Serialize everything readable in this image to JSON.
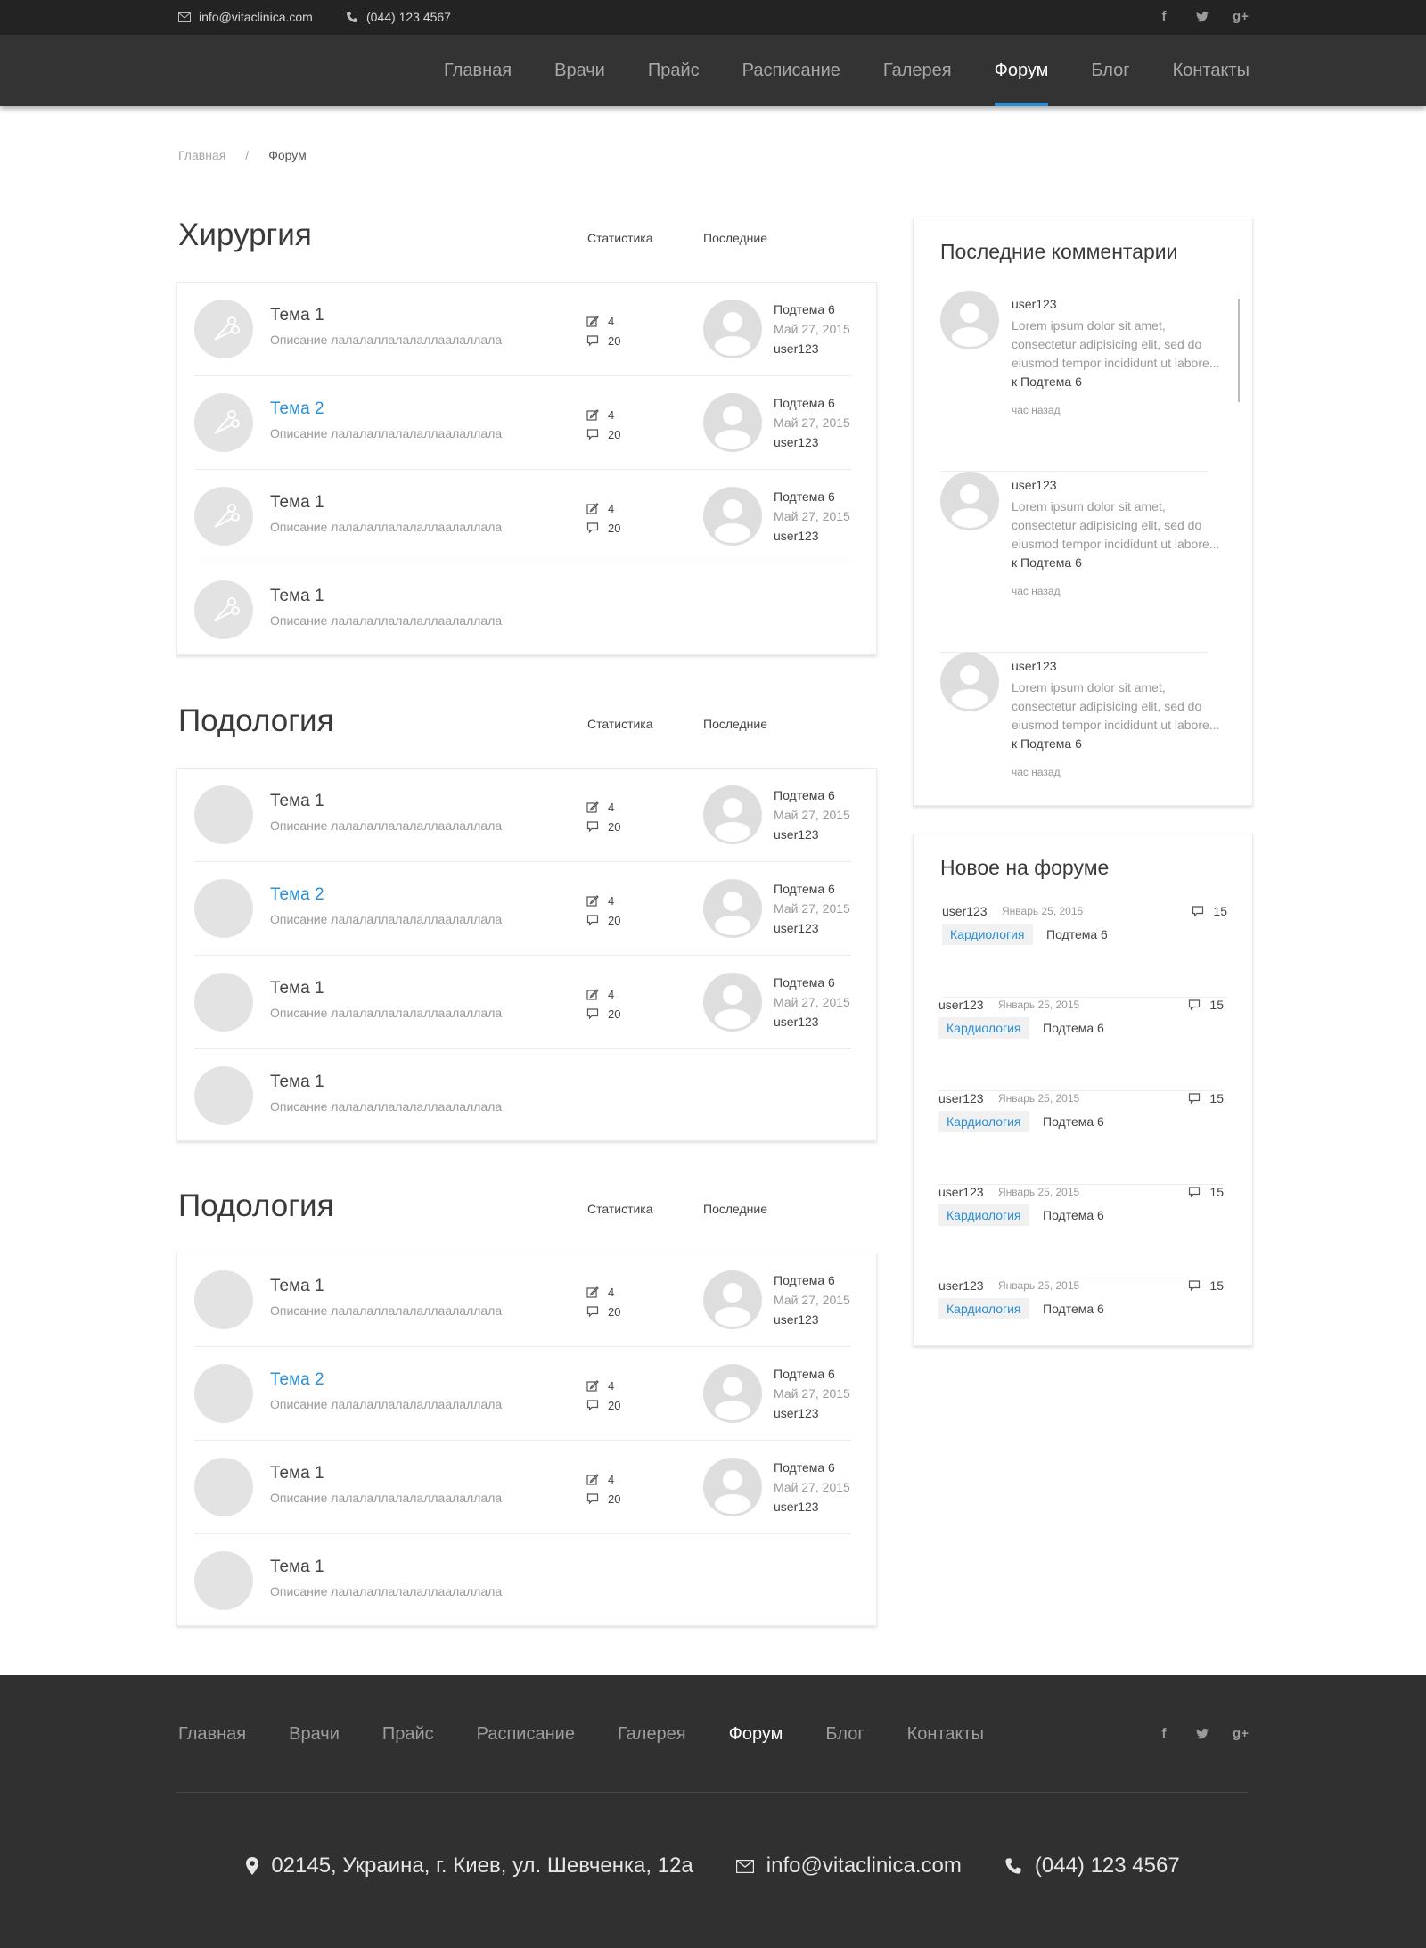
{
  "topbar": {
    "email": "info@vitaclinica.com",
    "phone": "(044) 123 4567",
    "social": [
      "facebook-icon",
      "twitter-icon",
      "google-plus-icon"
    ]
  },
  "nav": {
    "items": [
      "Главная",
      "Врачи",
      "Прайс",
      "Расписание",
      "Галерея",
      "Форум",
      "Блог",
      "Контакты"
    ],
    "active": "Форум",
    "accent": "#2b8fd6"
  },
  "breadcrumb": {
    "home": "Главная",
    "separator": "/",
    "current": "Форум"
  },
  "sections": [
    {
      "title": "Хирургия",
      "stats_label": "Статистика",
      "last_label": "Последние",
      "rows": [
        {
          "title": "Тема 1",
          "desc": "Описание лалалаллалалаллаалаллала",
          "posts": "4",
          "comments": "20",
          "last_sub": "Подтема 6",
          "last_date": "Май 27, 2015",
          "last_user": "user123"
        },
        {
          "title": "Тема 2",
          "desc": "Описание лалалаллалалаллаалаллала",
          "posts": "4",
          "comments": "20",
          "last_sub": "Подтема 6",
          "last_date": "Май 27, 2015",
          "last_user": "user123"
        },
        {
          "title": "Тема 1",
          "desc": "Описание лалалаллалалаллаалаллала",
          "posts": "4",
          "comments": "20",
          "last_sub": "Подтема 6",
          "last_date": "Май 27, 2015",
          "last_user": "user123"
        },
        {
          "title": "Тема 1",
          "desc": "Описание лалалаллалалаллаалаллала"
        }
      ]
    },
    {
      "title": "Подология",
      "stats_label": "Статистика",
      "last_label": "Последние",
      "rows": [
        {
          "title": "Тема 1",
          "desc": "Описание лалалаллалалаллаалаллала",
          "posts": "4",
          "comments": "20",
          "last_sub": "Подтема 6",
          "last_date": "Май 27, 2015",
          "last_user": "user123"
        },
        {
          "title": "Тема 2",
          "desc": "Описание лалалаллалалаллаалаллала",
          "posts": "4",
          "comments": "20",
          "last_sub": "Подтема 6",
          "last_date": "Май 27, 2015",
          "last_user": "user123"
        },
        {
          "title": "Тема 1",
          "desc": "Описание лалалаллалалаллаалаллала",
          "posts": "4",
          "comments": "20",
          "last_sub": "Подтема 6",
          "last_date": "Май 27, 2015",
          "last_user": "user123"
        },
        {
          "title": "Тема 1",
          "desc": "Описание лалалаллалалаллаалаллала"
        }
      ]
    },
    {
      "title": "Подология",
      "stats_label": "Статистика",
      "last_label": "Последние",
      "rows": [
        {
          "title": "Тема 1",
          "desc": "Описание лалалаллалалаллаалаллала",
          "posts": "4",
          "comments": "20",
          "last_sub": "Подтема 6",
          "last_date": "Май 27, 2015",
          "last_user": "user123"
        },
        {
          "title": "Тема 2",
          "desc": "Описание лалалаллалалаллаалаллала",
          "posts": "4",
          "comments": "20",
          "last_sub": "Подтема 6",
          "last_date": "Май 27, 2015",
          "last_user": "user123"
        },
        {
          "title": "Тема 1",
          "desc": "Описание лалалаллалалаллаалаллала",
          "posts": "4",
          "comments": "20",
          "last_sub": "Подтема 6",
          "last_date": "Май 27, 2015",
          "last_user": "user123"
        },
        {
          "title": "Тема 1",
          "desc": "Описание лалалаллалалаллаалаллала"
        }
      ]
    }
  ],
  "recent_comments": {
    "title": "Последние комментарии",
    "items": [
      {
        "user": "user123",
        "text": "Lorem ipsum dolor sit amet, consectetur adipisicing elit, sed do eiusmod tempor incididunt ut labore...",
        "topic": "к Подтема 6",
        "time": "час назад"
      },
      {
        "user": "user123",
        "text": "Lorem ipsum dolor sit amet, consectetur adipisicing elit, sed do eiusmod tempor incididunt ut labore...",
        "topic": "к Подтема 6",
        "time": "час назад"
      },
      {
        "user": "user123",
        "text": "Lorem ipsum dolor sit amet, consectetur adipisicing elit, sed do eiusmod tempor incididunt ut labore...",
        "topic": "к Подтема 6",
        "time": "час назад"
      }
    ]
  },
  "new_on_forum": {
    "title": "Новое на форуме",
    "items": [
      {
        "user": "user123",
        "date": "Январь 25, 2015",
        "count": "15",
        "tag": "Кардиология",
        "topic": "Подтема 6"
      },
      {
        "user": "user123",
        "date": "Январь 25, 2015",
        "count": "15",
        "tag": "Кардиология",
        "topic": "Подтема 6"
      },
      {
        "user": "user123",
        "date": "Январь 25, 2015",
        "count": "15",
        "tag": "Кардиология",
        "topic": "Подтема 6"
      },
      {
        "user": "user123",
        "date": "Январь 25, 2015",
        "count": "15",
        "tag": "Кардиология",
        "topic": "Подтема 6"
      },
      {
        "user": "user123",
        "date": "Январь 25, 2015",
        "count": "15",
        "tag": "Кардиология",
        "topic": "Подтема 6"
      }
    ]
  },
  "footer": {
    "nav": [
      "Главная",
      "Врачи",
      "Прайс",
      "Расписание",
      "Галерея",
      "Форум",
      "Блог",
      "Контакты"
    ],
    "active": "Форум",
    "address": "02145, Украина, г. Киев, ул. Шевченка, 12а",
    "email": "info@vitaclinica.com",
    "phone": "(044) 123 4567"
  }
}
